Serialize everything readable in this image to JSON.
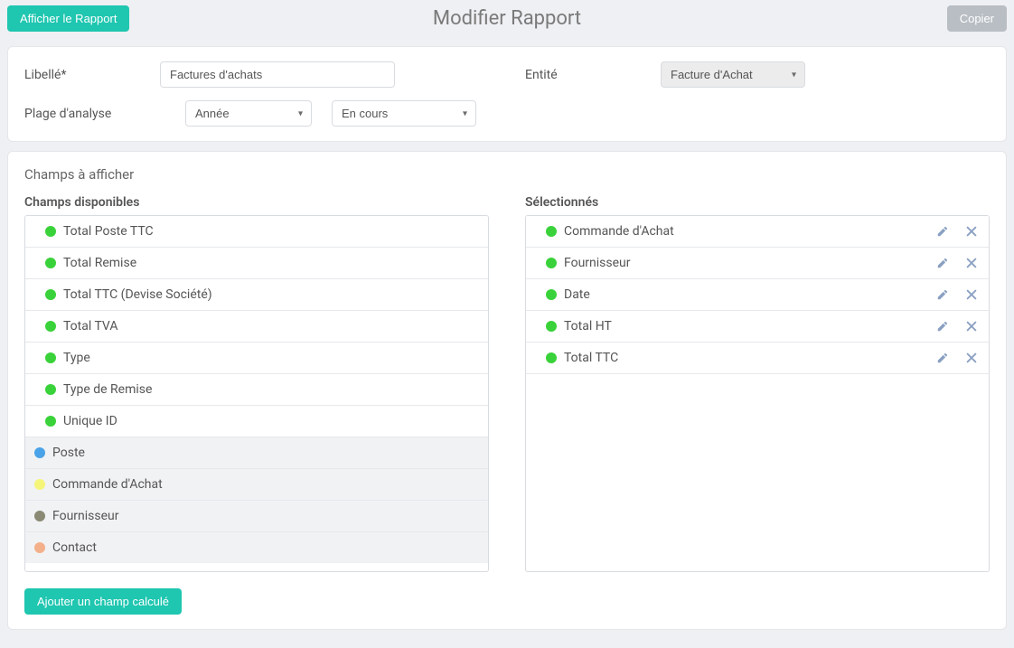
{
  "header": {
    "show_report_btn": "Afficher le Rapport",
    "title": "Modifier Rapport",
    "copy_btn": "Copier"
  },
  "form": {
    "label_label": "Libellé*",
    "label_value": "Factures d'achats",
    "entity_label": "Entité",
    "entity_value": "Facture d'Achat",
    "range_label": "Plage d'analyse",
    "range_period": "Année",
    "range_status": "En cours"
  },
  "fields_panel": {
    "title": "Champs à afficher",
    "available_header": "Champs disponibles",
    "selected_header": "Sélectionnés",
    "available": [
      {
        "label": "Total Poste TTC",
        "color": "green",
        "section": false
      },
      {
        "label": "Total Remise",
        "color": "green",
        "section": false
      },
      {
        "label": "Total TTC (Devise Société)",
        "color": "green",
        "section": false
      },
      {
        "label": "Total TVA",
        "color": "green",
        "section": false
      },
      {
        "label": "Type",
        "color": "green",
        "section": false
      },
      {
        "label": "Type de Remise",
        "color": "green",
        "section": false
      },
      {
        "label": "Unique ID",
        "color": "green",
        "section": false
      },
      {
        "label": "Poste",
        "color": "blue",
        "section": true
      },
      {
        "label": "Commande d'Achat",
        "color": "yellow",
        "section": true
      },
      {
        "label": "Fournisseur",
        "color": "olive",
        "section": true
      },
      {
        "label": "Contact",
        "color": "orange",
        "section": true
      }
    ],
    "selected": [
      {
        "label": "Commande d'Achat",
        "color": "green"
      },
      {
        "label": "Fournisseur",
        "color": "green"
      },
      {
        "label": "Date",
        "color": "green"
      },
      {
        "label": "Total HT",
        "color": "green"
      },
      {
        "label": "Total TTC",
        "color": "green"
      }
    ],
    "add_calc_btn": "Ajouter un champ calculé"
  }
}
